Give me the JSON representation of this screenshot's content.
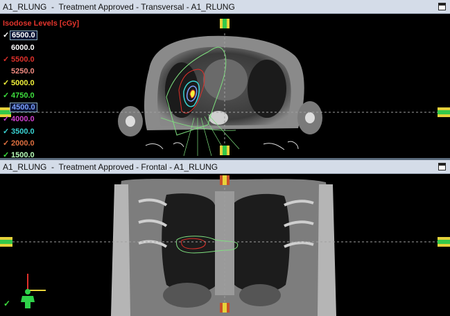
{
  "transversal": {
    "title": "A1_RLUNG  -  Treatment Approved - Transversal - A1_RLUNG"
  },
  "frontal": {
    "title": "A1_RLUNG  -  Treatment Approved - Frontal - A1_RLUNG"
  },
  "isodose": {
    "header": "Isodose Levels [cGy]",
    "levels": [
      {
        "value": "6500.0",
        "color": "#ffffff",
        "checked": true,
        "check_color": "#ffffff",
        "boxed": true
      },
      {
        "value": "6000.0",
        "color": "#ffffff",
        "checked": false,
        "check_color": "#ffffff",
        "boxed": false
      },
      {
        "value": "5500.0",
        "color": "#e0302a",
        "checked": true,
        "check_color": "#e0302a",
        "boxed": false
      },
      {
        "value": "5250.0",
        "color": "#f08a80",
        "checked": false,
        "check_color": "#f08a80",
        "boxed": false
      },
      {
        "value": "5000.0",
        "color": "#f2f23a",
        "checked": true,
        "check_color": "#f2f23a",
        "boxed": false
      },
      {
        "value": "4750.0",
        "color": "#3ee03e",
        "checked": true,
        "check_color": "#3ee03e",
        "boxed": false
      },
      {
        "value": "4500.0",
        "color": "#7aa0ff",
        "checked": false,
        "check_color": "#7aa0ff",
        "boxed": true
      },
      {
        "value": "4000.0",
        "color": "#d040d0",
        "checked": true,
        "check_color": "#d040d0",
        "boxed": false
      },
      {
        "value": "3500.0",
        "color": "#3ad4d4",
        "checked": true,
        "check_color": "#3ad4d4",
        "boxed": false
      },
      {
        "value": "2000.0",
        "color": "#e07040",
        "checked": true,
        "check_color": "#e07040",
        "boxed": false
      },
      {
        "value": "1500.0",
        "color": "#b8ffb8",
        "checked": true,
        "check_color": "#3ee03e",
        "boxed": false
      }
    ]
  },
  "colors": {
    "marker_green": "#35c84a",
    "marker_yellow": "#e6d23a",
    "marker_red": "#c7502a",
    "contour_green": "#7fe07f",
    "crosshair": "#a0a0a0"
  },
  "icons": {
    "orientation": "orientation-axes-icon",
    "patient": "patient-figure-icon",
    "check": "check-icon"
  }
}
